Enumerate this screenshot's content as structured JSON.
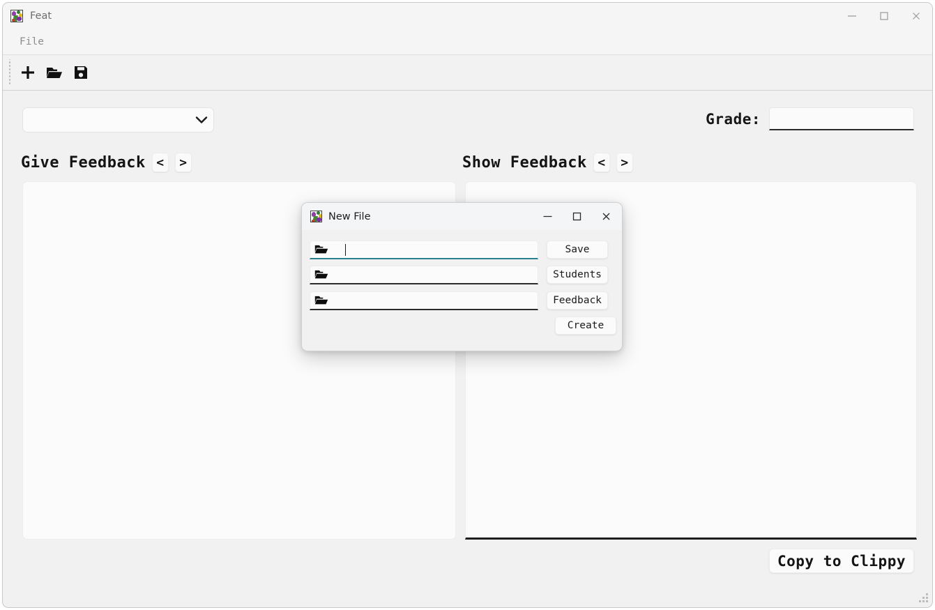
{
  "app": {
    "title": "Feat",
    "icon": "app-logo-icon"
  },
  "window_controls": {
    "minimize": "minimize-icon",
    "maximize": "maximize-icon",
    "close": "close-icon"
  },
  "menubar": {
    "items": [
      {
        "label": "File"
      }
    ]
  },
  "toolbar": {
    "buttons": [
      {
        "name": "new-file",
        "icon": "plus-icon"
      },
      {
        "name": "open-file",
        "icon": "open-folder-icon"
      },
      {
        "name": "save-file",
        "icon": "floppy-disk-save-icon"
      }
    ]
  },
  "controls": {
    "student_select": {
      "value": "",
      "placeholder": "",
      "chevron": "chevron-down-icon"
    },
    "grade": {
      "label": "Grade:",
      "value": "",
      "placeholder": ""
    }
  },
  "panels": {
    "give": {
      "title": "Give Feedback",
      "prev": "<",
      "next": ">",
      "text": "",
      "placeholder": ""
    },
    "show": {
      "title": "Show Feedback",
      "prev": "<",
      "next": ">",
      "text": "",
      "placeholder": ""
    }
  },
  "actions": {
    "copy_to_clippy": "Copy to Clippy"
  },
  "modal": {
    "title": "New File",
    "icon": "app-logo-icon",
    "window_controls": {
      "minimize": "minimize-icon",
      "maximize": "maximize-icon",
      "close": "close-icon"
    },
    "fields": [
      {
        "name": "save-path",
        "icon": "open-folder-icon",
        "value": "",
        "placeholder": "",
        "focused": true
      },
      {
        "name": "students-path",
        "icon": "open-folder-icon",
        "value": "",
        "placeholder": "",
        "focused": false
      },
      {
        "name": "feedback-path",
        "icon": "open-folder-icon",
        "value": "",
        "placeholder": "",
        "focused": false
      }
    ],
    "buttons": [
      {
        "name": "save",
        "label": "Save"
      },
      {
        "name": "students",
        "label": "Students"
      },
      {
        "name": "feedback",
        "label": "Feedback"
      },
      {
        "name": "create",
        "label": "Create"
      }
    ]
  },
  "colors": {
    "window_bg": "#f1f1f1",
    "panel_bg": "#fbfbfb",
    "focus_underline": "#2a7f8f",
    "underline": "#2b2b2b",
    "title_text": "#6d6d6d"
  }
}
